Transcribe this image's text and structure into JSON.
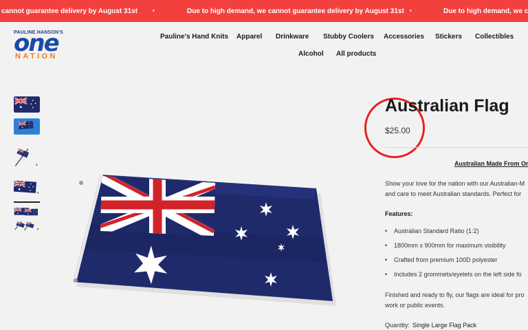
{
  "banner": {
    "messages": [
      "cannot guarantee delivery by August 31st",
      "Due to high demand, we cannot guarantee delivery by August 31st",
      "Due to high demand, we ca"
    ],
    "separator": "•"
  },
  "logo": {
    "top_text": "PAULINE HANSON'S",
    "main": "one",
    "sub": "NATION"
  },
  "nav": {
    "items": [
      "Pauline's Hand Knits",
      "Apparel",
      "Drinkware",
      "Stubby Coolers",
      "Accessories",
      "Stickers",
      "Collectibles",
      "Alcohol",
      "All products"
    ]
  },
  "product": {
    "title": "Australian Flag",
    "price": "$25.00",
    "made_in": "Australian Made From On",
    "description": [
      "Show your love for the nation with our Australian-M",
      "and care to meet Australian standards. Perfect for"
    ],
    "features_title": "Features:",
    "features": [
      "Australian Standard Ratio (1:2)",
      "1800mm x 900mm for maximum visibility",
      "Crafted from premium 100D polyester",
      "Includes 2 grommets/eyelets on the left side fo"
    ],
    "closing": [
      "Finished and ready to fly, our flags are ideal for pro",
      "work or public events."
    ],
    "quantity_label": "Quantity:",
    "quantity_value": "Single Large Flag Pack"
  },
  "colors": {
    "banner": "#f2403f",
    "flag_blue": "#1f2a6b",
    "flag_red": "#d2232a",
    "logo_blue": "#1a4aa8",
    "logo_orange": "#f07a1d",
    "annotation_circle": "#e8201f"
  }
}
